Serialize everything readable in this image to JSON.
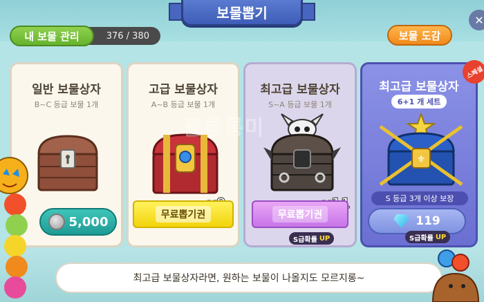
{
  "header": {
    "title": "보물뽑기"
  },
  "top_bar": {
    "manage_label": "내 보물 관리",
    "count": "376 / 380",
    "dex_label": "보물 도감"
  },
  "watermark": "홀롱롱미",
  "cards": [
    {
      "title": "일반 보물상자",
      "subtitle": "B~C 등급 보물 1개",
      "price": "5,000"
    },
    {
      "title": "고급 보물상자",
      "subtitle": "A~B 등급 보물 1개",
      "ticket": "무료뽑기권",
      "multiplier": "x9"
    },
    {
      "title": "최고급 보물상자",
      "subtitle": "S~A 등급 보물 1개",
      "ticket": "무료뽑기권",
      "multiplier": "x11",
      "rate_prefix": "S급확률",
      "rate_suffix": "UP"
    },
    {
      "title": "최고급 보물상자",
      "set_label": "6+1 개 세트",
      "event_badge": "스페셜",
      "guarantee": "S 등급 3개 이상 보장",
      "price": "119",
      "rate_prefix": "S급확률",
      "rate_suffix": "UP"
    }
  ],
  "dialog": {
    "text": "최고급 보물상자라면, 원하는 보물이 나올지도 모르지롱~"
  },
  "colors": {
    "accent": "#3e5db8",
    "green": "#66b32e",
    "orange": "#f08a1c",
    "teal": "#1e9c96",
    "purple": "#6a6fd2"
  }
}
